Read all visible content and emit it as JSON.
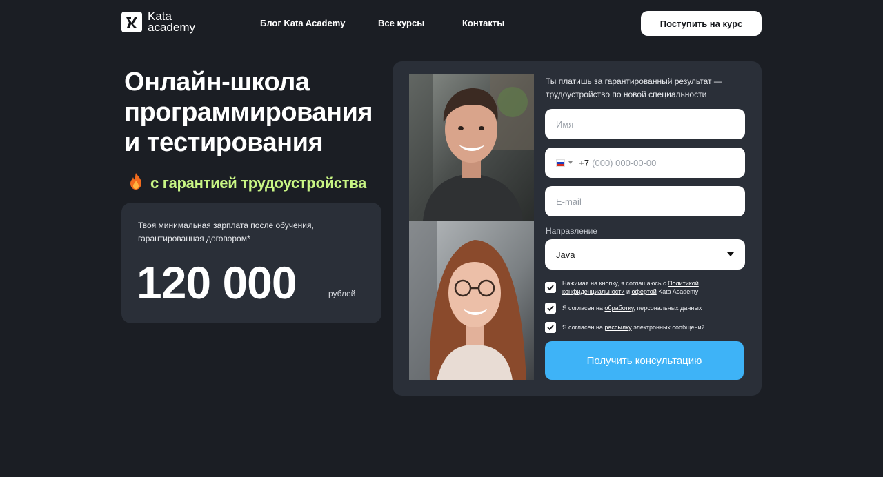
{
  "header": {
    "logo_line1": "Kata",
    "logo_line2": "academy",
    "nav": [
      "Блог Kata Academy",
      "Все курсы",
      "Контакты"
    ],
    "cta_label": "Поступить на курс"
  },
  "hero": {
    "title": "Онлайн-школа программирования и тестирования",
    "guarantee": "с гарантией трудоустройства",
    "guarantee_icon": "fire-icon",
    "accent_color": "#c8f584"
  },
  "salary": {
    "caption": "Твоя минимальная зарплата после обучения, гарантированная договором*",
    "amount": "120 000",
    "unit": "рублей"
  },
  "form": {
    "intro": "Ты платишь за гарантированный результат — трудоустройство по новой специальности",
    "name_placeholder": "Имя",
    "phone_country": "ru-flag-icon",
    "phone_code": "+7",
    "phone_placeholder": "(000) 000-00-00",
    "email_placeholder": "E-mail",
    "direction_label": "Направление",
    "direction_value": "Java",
    "consents": [
      {
        "prefix": "Нажимая на кнопку, я соглашаюсь с ",
        "link1": "Политикой конфиденциальности",
        "middle": " и ",
        "link2": "офертой",
        "suffix": " Kata Academy",
        "checked": true
      },
      {
        "prefix": "Я согласен на ",
        "link1": "обработку",
        "suffix": ", персональных данных",
        "checked": true
      },
      {
        "prefix": "Я согласен на ",
        "link1": "рассылку",
        "suffix": " электронных сообщений",
        "checked": true
      }
    ],
    "submit_label": "Получить консультацию",
    "submit_color": "#3eb3f7"
  }
}
